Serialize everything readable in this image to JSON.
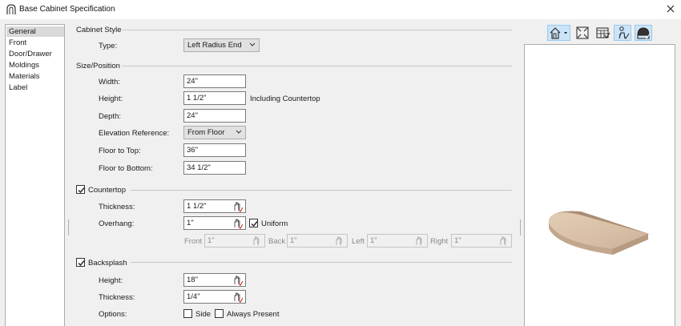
{
  "window": {
    "title": "Base Cabinet Specification"
  },
  "nav": {
    "items": [
      "General",
      "Front",
      "Door/Drawer",
      "Moldings",
      "Materials",
      "Label"
    ],
    "selected": "General"
  },
  "cabinet_style": {
    "section": "Cabinet Style",
    "type_label": "Type:",
    "type_value": "Left Radius End"
  },
  "size_position": {
    "section": "Size/Position",
    "width_label": "Width:",
    "width_value": "24\"",
    "height_label": "Height:",
    "height_value": "1 1/2\"",
    "height_note": "Including Countertop",
    "depth_label": "Depth:",
    "depth_value": "24\"",
    "elev_label": "Elevation Reference:",
    "elev_value": "From Floor",
    "floor_top_label": "Floor to Top:",
    "floor_top_value": "36\"",
    "floor_bottom_label": "Floor to Bottom:",
    "floor_bottom_value": "34 1/2\""
  },
  "countertop": {
    "section": "Countertop",
    "checked": true,
    "thickness_label": "Thickness:",
    "thickness_value": "1 1/2\"",
    "overhang_label": "Overhang:",
    "overhang_value": "1\"",
    "uniform_label": "Uniform",
    "uniform_checked": true,
    "front_label": "Front",
    "front_value": "1\"",
    "back_label": "Back",
    "back_value": "1\"",
    "left_label": "Left",
    "left_value": "1\"",
    "right_label": "Right",
    "right_value": "1\""
  },
  "backsplash": {
    "section": "Backsplash",
    "checked": true,
    "height_label": "Height:",
    "height_value": "18\"",
    "thickness_label": "Thickness:",
    "thickness_value": "1/4\"",
    "options_label": "Options:",
    "side_label": "Side",
    "side_checked": false,
    "always_label": "Always Present",
    "always_checked": false
  },
  "preview_toolbar": [
    "view-type-icon",
    "fill-window-icon",
    "show-cabinet-icon",
    "toggle-rendering-icon",
    "toggle-lighting-icon"
  ],
  "colors": {
    "accent": "#cce4f7",
    "countertop": "#d9c1aa"
  }
}
